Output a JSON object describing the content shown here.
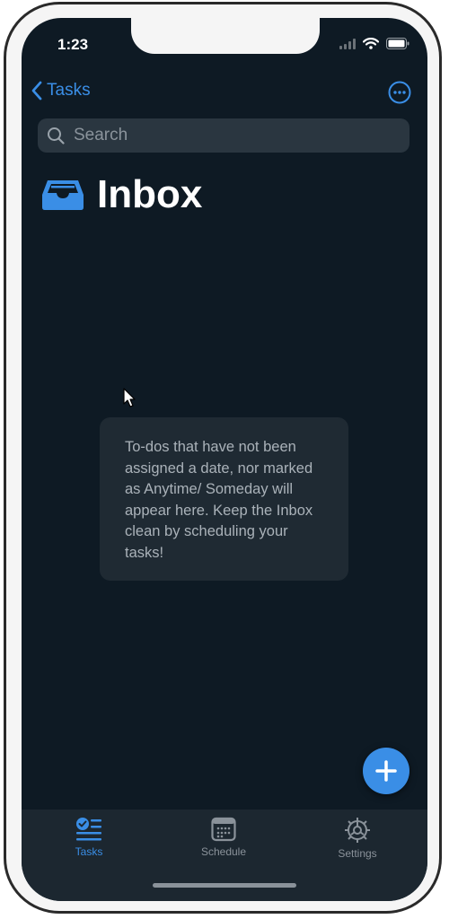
{
  "status_bar": {
    "time": "1:23"
  },
  "nav": {
    "back_label": "Tasks"
  },
  "search": {
    "placeholder": "Search"
  },
  "page": {
    "title": "Inbox"
  },
  "empty_state": {
    "message": "To-dos that have not been assigned a date, nor marked as Anytime/ Someday will appear here. Keep the Inbox clean by scheduling your tasks!"
  },
  "tabs": [
    {
      "label": "Tasks",
      "icon": "tasks-icon",
      "active": true
    },
    {
      "label": "Schedule",
      "icon": "calendar-icon",
      "active": false
    },
    {
      "label": "Settings",
      "icon": "gear-icon",
      "active": false
    }
  ],
  "colors": {
    "background": "#0e1a24",
    "accent": "#3a8ee6",
    "card": "#1f2a33",
    "tabbar": "#1c2730"
  }
}
